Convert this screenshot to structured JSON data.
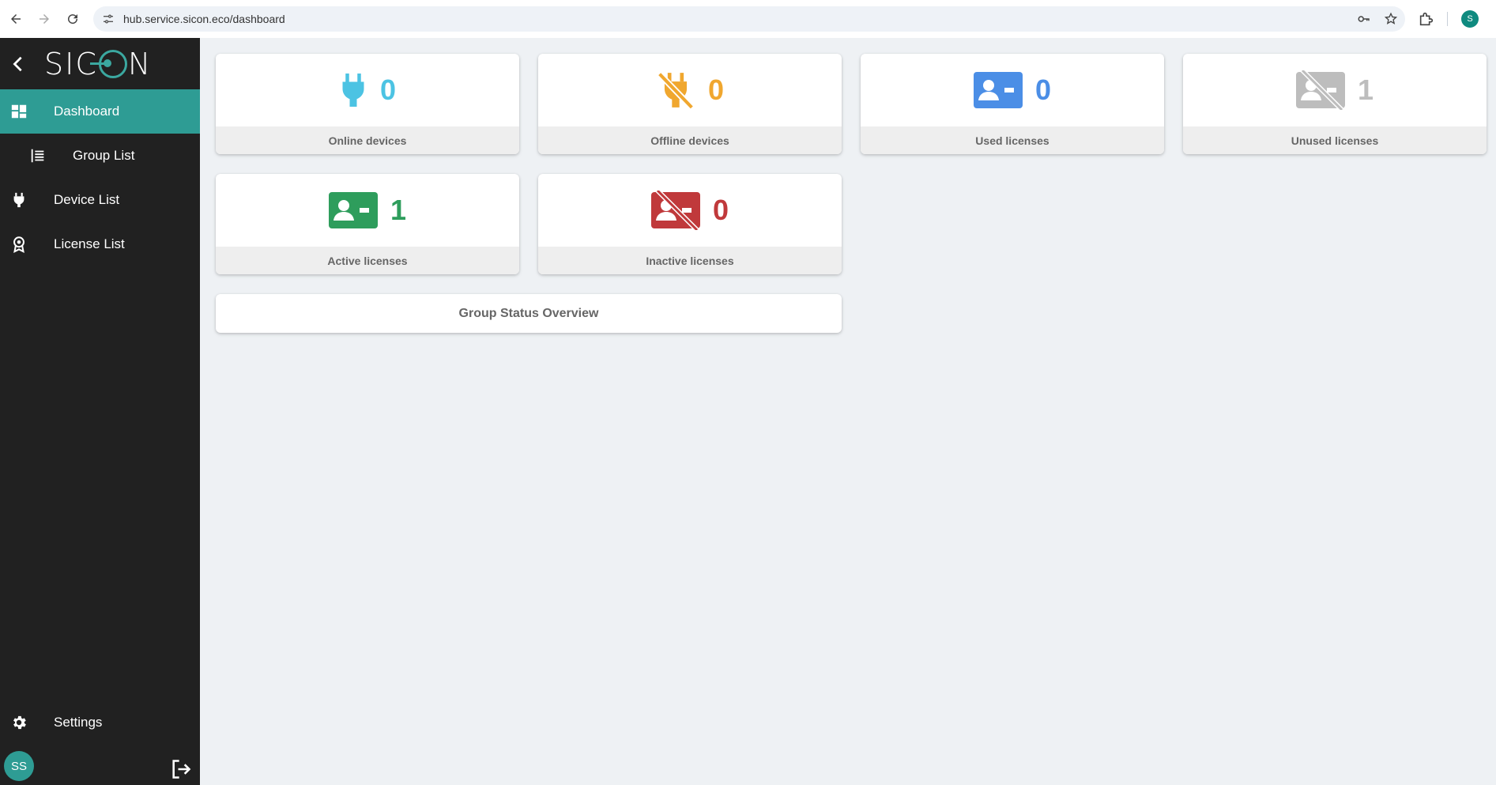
{
  "browser": {
    "url": "hub.service.sicon.eco/dashboard",
    "profile_initial": "S"
  },
  "sidebar": {
    "brand": {
      "logo_left": "SIC",
      "logo_right": "N"
    },
    "items": [
      {
        "label": "Dashboard",
        "icon": "dashboard-grid-icon",
        "active": true
      },
      {
        "label": "Group List",
        "icon": "list-icon",
        "sub": true
      },
      {
        "label": "Device List",
        "icon": "plug-icon"
      },
      {
        "label": "License List",
        "icon": "badge-icon"
      }
    ],
    "settings_label": "Settings",
    "user_initials": "SS"
  },
  "cards": [
    {
      "value": "0",
      "label": "Online devices",
      "color": "#4cc3e3",
      "icon": "plug-icon"
    },
    {
      "value": "0",
      "label": "Offline devices",
      "color": "#f0a72f",
      "icon": "plug-off-icon"
    },
    {
      "value": "0",
      "label": "Used licenses",
      "color": "#4b8ee6",
      "icon": "id-card-icon"
    },
    {
      "value": "1",
      "label": "Unused licenses",
      "color": "#bdbdbd",
      "icon": "id-card-off-icon"
    },
    {
      "value": "1",
      "label": "Active licenses",
      "color": "#2e9d5c",
      "icon": "id-card-icon"
    },
    {
      "value": "0",
      "label": "Inactive licenses",
      "color": "#c0393b",
      "icon": "id-card-off-icon"
    }
  ],
  "overview": {
    "label": "Group Status Overview"
  }
}
